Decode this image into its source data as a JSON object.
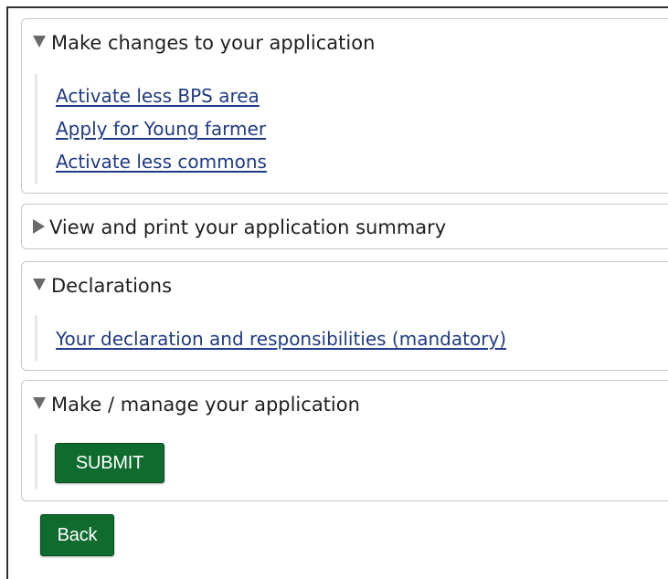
{
  "panels": {
    "changes": {
      "title": "Make changes to your application",
      "links": [
        "Activate less BPS area",
        "Apply for Young farmer",
        "Activate less commons"
      ]
    },
    "summary": {
      "title": "View and print your application summary"
    },
    "declarations": {
      "title": "Declarations",
      "link": "Your declaration and responsibilities (mandatory)"
    },
    "manage": {
      "title": "Make / manage your application",
      "submit_label": "SUBMIT"
    }
  },
  "back_label": "Back",
  "colors": {
    "link": "#1f3b86",
    "button_green": "#0f6b2e",
    "arrow": "#6a6a6a",
    "panel_border": "#c8c8c8"
  },
  "icons": {
    "expanded": "triangle-down-icon",
    "collapsed": "triangle-right-icon"
  }
}
